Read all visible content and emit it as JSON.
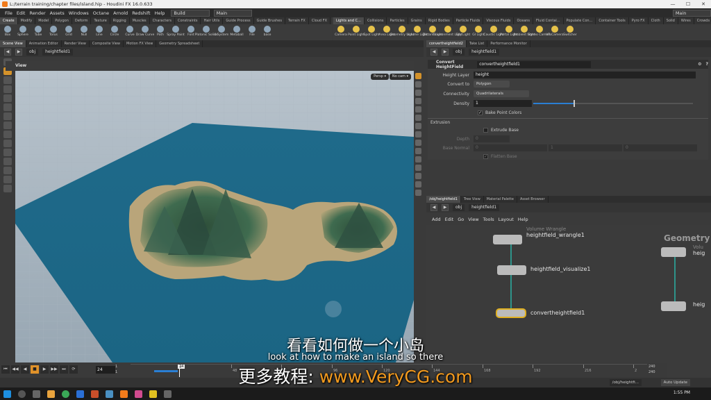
{
  "titlebar": {
    "title": "L:/terrain training/chapter files/island.hip - Houdini FX 16.0.633",
    "min": "—",
    "max": "☐",
    "close": "✕"
  },
  "menubar": {
    "items": [
      "File",
      "Edit",
      "Render",
      "Assets",
      "Windows",
      "Octane",
      "Arnold",
      "Redshift",
      "Help"
    ],
    "desktop": "Build",
    "layout": "Main",
    "right_layout": "Main"
  },
  "shelf_left": {
    "tabs": [
      "Create",
      "Modify",
      "Model",
      "Polygon",
      "Deform",
      "Texture",
      "Rigging",
      "Muscles",
      "Characters",
      "Constraints",
      "Hair Utils",
      "Guide Process",
      "Guide Brushes",
      "Terrain FX",
      "Cloud FX",
      "Volume"
    ],
    "tools": [
      "Box",
      "Sphere",
      "Tube",
      "Torus",
      "Grid",
      "Null",
      "Line",
      "Circle",
      "Curve",
      "Draw Curve",
      "Path",
      "Spray Paint",
      "Font",
      "Platonic Solids",
      "L-System",
      "Metaball",
      "File",
      "base"
    ]
  },
  "shelf_right": {
    "tabs": [
      "Lights and C...",
      "Collisions",
      "Particles",
      "Grains",
      "Rigid Bodies",
      "Particle Fluids",
      "Viscous Fluids",
      "Oceans",
      "Fluid Contai...",
      "Populate Con...",
      "Container Tools",
      "Pyro FX",
      "Cloth",
      "Solid",
      "Wires",
      "Crowds",
      "Drive Simula..."
    ],
    "tools": [
      "Camera",
      "Point Light",
      "Spot Light",
      "Area Light",
      "Geometry Light",
      "Volume Light",
      "Distant Light",
      "Environment Light",
      "Sky Light",
      "GI Light",
      "Caustic Light",
      "Portal Light",
      "Ambient Light",
      "Stereo Camera",
      "VR Camera",
      "Switcher"
    ]
  },
  "left_pane": {
    "tabs": [
      "Scene View",
      "Animation Editor",
      "Render View",
      "Composite View",
      "Motion FX View",
      "Geometry Spreadsheet"
    ],
    "path": [
      "obj",
      "heightfield1"
    ],
    "view_label": "View",
    "persp": "Persp ▾",
    "cam": "No cam ▾"
  },
  "param_pane": {
    "tabs": [
      "convertheightfield2",
      "Take List",
      "Performance Monitor"
    ],
    "path": [
      "obj",
      "heightfield1"
    ],
    "node_type": "Convert HeightField",
    "node_name": "convertheightfield1",
    "height_layer_label": "Height Layer",
    "height_layer": "height",
    "convert_to_label": "Convert to",
    "convert_to": "Polygon",
    "connectivity_label": "Connectivity",
    "connectivity": "Quadrilaterals",
    "density_label": "Density",
    "density": "1",
    "density_fraction": 0.25,
    "bake_label": "Bake Point Colors",
    "extrusion_label": "Extrusion",
    "extrude_label": "Extrude Base",
    "depth_label": "Depth",
    "depth": "0",
    "base_normal_label": "Base Normal",
    "base_normal": [
      "0",
      "1",
      "0"
    ],
    "flatten_label": "Flatten Base"
  },
  "net_pane": {
    "tabs": [
      "/obj/heightfield1",
      "Tree View",
      "Material Palette",
      "Asset Browser"
    ],
    "path": [
      "obj",
      "heightfield1"
    ],
    "menu": [
      "Add",
      "Edit",
      "Go",
      "View",
      "Tools",
      "Layout",
      "Help"
    ],
    "context_label": "Geometry",
    "nodes": [
      {
        "type": "Volume Wrangle",
        "name": "heightfield_wrangle1"
      },
      {
        "type": "",
        "name": "heightfield_visualize1"
      },
      {
        "type": "",
        "name": "convertheightfield1"
      }
    ],
    "partial_label": "heig",
    "partial_type": "Volu"
  },
  "timeline": {
    "frame": "24",
    "start": "1",
    "start2": "1",
    "end": "240",
    "end2": "240",
    "ticks": [
      "24",
      "48",
      "72",
      "96",
      "120",
      "144",
      "168",
      "192",
      "216",
      "2"
    ],
    "playhead": "24"
  },
  "statusbar": {
    "path": "/obj/heightfi...",
    "update": "Auto Update"
  },
  "taskbar": {
    "clock": "1:55 PM"
  },
  "subtitles": {
    "cn": "看看如何做一个小岛",
    "en": "look at how to make an island so there",
    "promo_cn": "更多教程: ",
    "promo_url": "www.VeryCG.com"
  }
}
